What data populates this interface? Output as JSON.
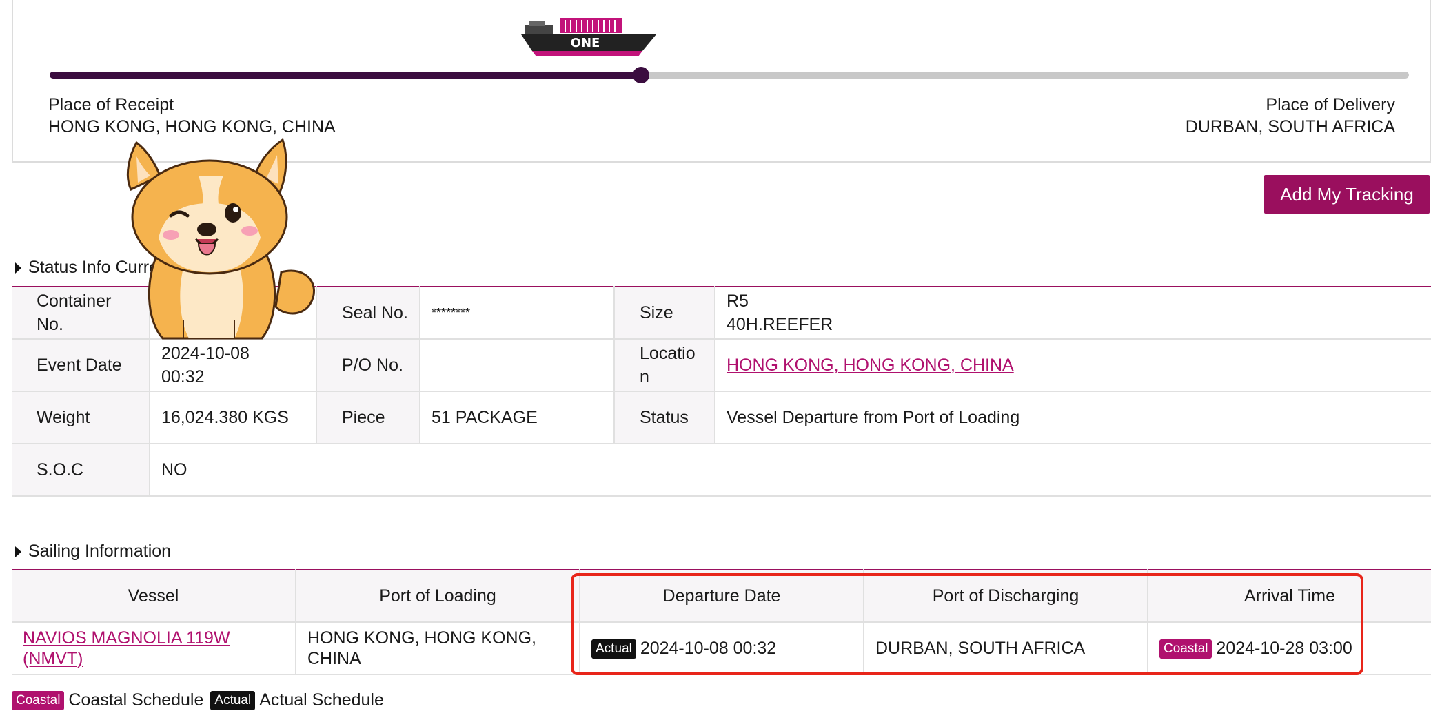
{
  "route": {
    "progress": 0.435,
    "ship_label": "ONE",
    "receipt": {
      "label": "Place of Receipt",
      "value": "HONG KONG, HONG KONG, CHINA"
    },
    "delivery": {
      "label": "Place of Delivery",
      "value": "DURBAN, SOUTH AFRICA"
    }
  },
  "actions": {
    "add_tracking": "Add My Tracking"
  },
  "status_info": {
    "title": "Status Info Curre",
    "rows": [
      {
        "l1": "Container No.",
        "v1": "",
        "l2": "Seal No.",
        "v2": "********",
        "l3": "Size",
        "v3a": "R5",
        "v3b": "40H.REEFER"
      },
      {
        "l1": "Event Date",
        "v1a": "2024-10-08",
        "v1b": "00:32",
        "l2": "P/O No.",
        "v2": "",
        "l3": "Locatio n",
        "v3": "HONG KONG, HONG KONG, CHINA"
      },
      {
        "l1": "Weight",
        "v1": "16,024.380 KGS",
        "l2": "Piece",
        "v2": "51 PACKAGE",
        "l3": "Status",
        "v3": "Vessel Departure from Port of Loading"
      },
      {
        "l1": "S.O.C",
        "v1": "NO"
      }
    ]
  },
  "sailing": {
    "title": "Sailing Information",
    "headers": [
      "Vessel",
      "Port of Loading",
      "Departure Date",
      "Port of Discharging",
      "Arrival Time"
    ],
    "row": {
      "vessel_line1": "NAVIOS MAGNOLIA 119W",
      "vessel_line2": "(NMVT)",
      "pol_line1": "HONG KONG, HONG KONG,",
      "pol_line2": "CHINA",
      "dep_badge": "Actual",
      "dep_date": "2024-10-08 00:32",
      "pod": "DURBAN, SOUTH AFRICA",
      "arr_badge": "Coastal",
      "arr_date": "2024-10-28 03:00"
    }
  },
  "legend": {
    "coastal_badge": "Coastal",
    "coastal_text": "Coastal Schedule",
    "actual_badge": "Actual",
    "actual_text": "Actual Schedule"
  },
  "colors": {
    "brand": "#9a0f5e",
    "track_done": "#3b0d3f",
    "track_pending": "#c8c8c8",
    "highlight": "#e8251a"
  }
}
